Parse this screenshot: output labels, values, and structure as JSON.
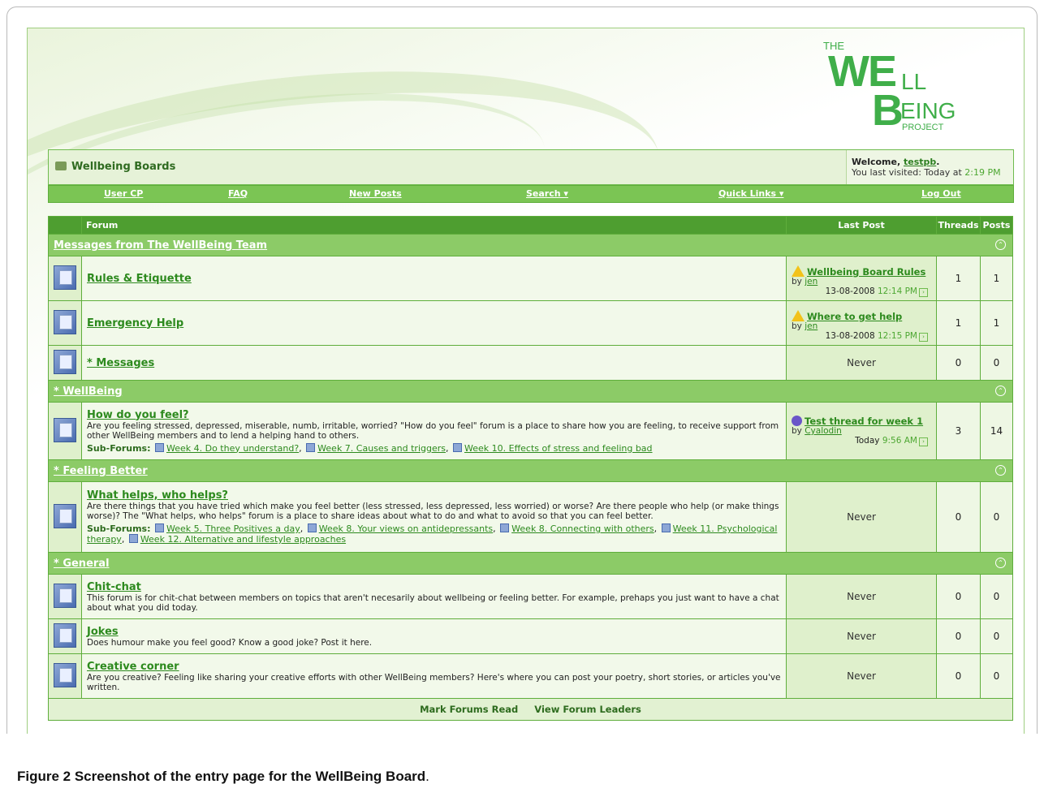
{
  "logo": {
    "the": "THE",
    "we": "WE",
    "ll": "LL",
    "b": "B",
    "eing": "EING",
    "project": "PROJECT"
  },
  "header": {
    "board_title": "Wellbeing Boards",
    "welcome_prefix": "Welcome, ",
    "username": "testpb",
    "welcome_suffix": ".",
    "last_visited_prefix": "You last visited: Today at ",
    "last_visited_time": "2:19 PM"
  },
  "nav": {
    "user_cp": "User CP",
    "faq": "FAQ",
    "new_posts": "New Posts",
    "search": "Search ▾",
    "quick_links": "Quick Links ▾",
    "log_out": "Log Out"
  },
  "table_headers": {
    "forum": "Forum",
    "last_post": "Last Post",
    "threads": "Threads",
    "posts": "Posts"
  },
  "categories": [
    {
      "name": "Messages from The WellBeing Team",
      "forums": [
        {
          "title": "Rules & Etiquette",
          "last_post": {
            "title": "Wellbeing Board Rules",
            "by": "by ",
            "user": "jen",
            "date": "13-08-2008",
            "time": "12:14 PM"
          },
          "threads": "1",
          "posts": "1"
        },
        {
          "title": "Emergency Help",
          "last_post": {
            "title": "Where to get help",
            "by": "by ",
            "user": "jen",
            "date": "13-08-2008",
            "time": "12:15 PM"
          },
          "threads": "1",
          "posts": "1"
        },
        {
          "title": "* Messages",
          "last_post_text": "Never",
          "threads": "0",
          "posts": "0"
        }
      ]
    },
    {
      "name": "* WellBeing",
      "forums": [
        {
          "title": "How do you feel?",
          "description": "Are you feeling stressed, depressed, miserable, numb, irritable, worried? \"How do you feel\" forum is a place to share how you are feeling, to receive support from other WellBeing members and to lend a helping hand to others.",
          "subforums_label": "Sub-Forums:",
          "subforums": [
            "Week 4. Do they understand?",
            "Week 7. Causes and triggers",
            "Week 10. Effects of stress and feeling bad"
          ],
          "last_post": {
            "title": "Test thread for week 1",
            "by": "by ",
            "user": "Cyalodin",
            "date": "Today",
            "time": "9:56 AM"
          },
          "threads": "3",
          "posts": "14"
        }
      ]
    },
    {
      "name": "* Feeling Better",
      "forums": [
        {
          "title": "What helps, who helps?",
          "description": "Are there things that you have tried which make you feel better (less stressed, less depressed, less worried) or worse? Are there people who help (or make things worse)? The \"What helps, who helps\" forum is a place to share ideas about what to do and what to avoid so that you can feel better.",
          "subforums_label": "Sub-Forums:",
          "subforums": [
            "Week 5. Three Positives a day",
            "Week 8. Your views on antidepressants",
            "Week 8. Connecting with others",
            "Week 11. Psychological therapy",
            "Week 12. Alternative and lifestyle approaches"
          ],
          "last_post_text": "Never",
          "threads": "0",
          "posts": "0"
        }
      ]
    },
    {
      "name": "* General",
      "forums": [
        {
          "title": "Chit-chat",
          "description": "This forum is for chit-chat between members on topics that aren't necesarily about wellbeing or feeling better. For example, prehaps you just want to have a chat about what you did today.",
          "last_post_text": "Never",
          "threads": "0",
          "posts": "0"
        },
        {
          "title": "Jokes",
          "description": "Does humour make you feel good? Know a good joke? Post it here.",
          "last_post_text": "Never",
          "threads": "0",
          "posts": "0"
        },
        {
          "title": "Creative corner",
          "description": "Are you creative? Feeling like sharing your creative efforts with other WellBeing members? Here's where you can post your poetry, short stories, or articles you've written.",
          "last_post_text": "Never",
          "threads": "0",
          "posts": "0"
        }
      ]
    }
  ],
  "footer": {
    "mark_read": "Mark Forums Read",
    "view_leaders": "View Forum Leaders"
  },
  "caption": {
    "label": "Figure 2",
    "text": " Screenshot of the entry page for the WellBeing Board",
    "end": "."
  }
}
